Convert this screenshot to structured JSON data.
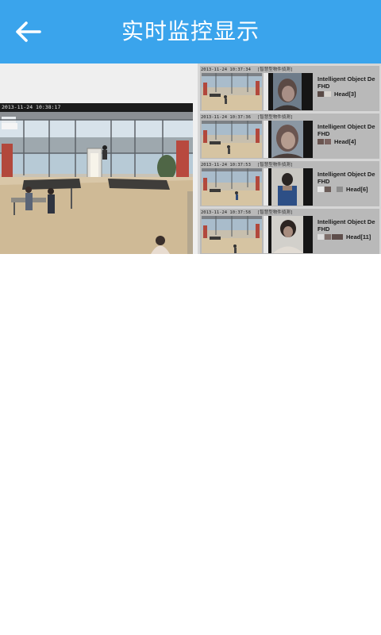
{
  "header": {
    "title": "实时监控显示",
    "back_icon": "arrow-left-icon",
    "background": "#3aa4ec"
  },
  "main_camera": {
    "timestamp": "2013-11-24 10:38:17"
  },
  "detections": [
    {
      "timestamp": "2013-11-24 10:37:34",
      "tag": "[智慧型物件偵測]",
      "title_line1": "Intelligent Object De",
      "title_line2": "FHD",
      "head_label": "Head[3]",
      "swatch_colors": [
        "#5a4a46",
        "#d8d4cf"
      ]
    },
    {
      "timestamp": "2013-11-24 10:37:36",
      "tag": "[智慧型物件偵測]",
      "title_line1": "Intelligent Object De",
      "title_line2": "FHD",
      "head_label": "Head[4]",
      "swatch_colors": [
        "#6a5550",
        "#7a6360"
      ]
    },
    {
      "timestamp": "2013-11-24 10:37:53",
      "tag": "[智慧型物件偵測]",
      "title_line1": "Intelligent Object De",
      "title_line2": "FHD",
      "head_label": "Head[6]",
      "swatch_colors": [
        "#e6e6e6",
        "#6a5b57",
        "#8d8d8d"
      ]
    },
    {
      "timestamp": "2013-11-24 10:37:58",
      "tag": "[智慧型物件偵測]",
      "title_line1": "Intelligent Object De",
      "title_line2": "FHD",
      "head_label": "Head[11]",
      "swatch_colors": [
        "#dcdcdc",
        "#7e6e6a",
        "#5e4e4b"
      ]
    }
  ]
}
